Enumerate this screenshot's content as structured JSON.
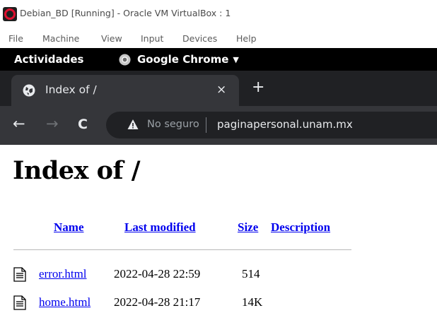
{
  "vbox": {
    "title": "Debian_BD [Running] - Oracle VM VirtualBox : 1",
    "menu": [
      "File",
      "Machine",
      "View",
      "Input",
      "Devices",
      "Help"
    ]
  },
  "gnome": {
    "activities": "Actividades",
    "app_name": "Google Chrome"
  },
  "chrome": {
    "tab_title": "Index of /",
    "close_glyph": "×",
    "newtab_glyph": "+",
    "back_glyph": "←",
    "forward_glyph": "→",
    "reload_glyph": "C",
    "security_label": "No seguro",
    "url": "paginapersonal.unam.mx"
  },
  "page": {
    "heading": "Index of /",
    "columns": {
      "name": "Name",
      "modified": "Last modified",
      "size": "Size",
      "description": "Description"
    },
    "files": [
      {
        "name": "error.html",
        "modified": "2022-04-28 22:59",
        "size": "514",
        "description": ""
      },
      {
        "name": "home.html",
        "modified": "2022-04-28 21:17",
        "size": "14K",
        "description": ""
      }
    ]
  }
}
